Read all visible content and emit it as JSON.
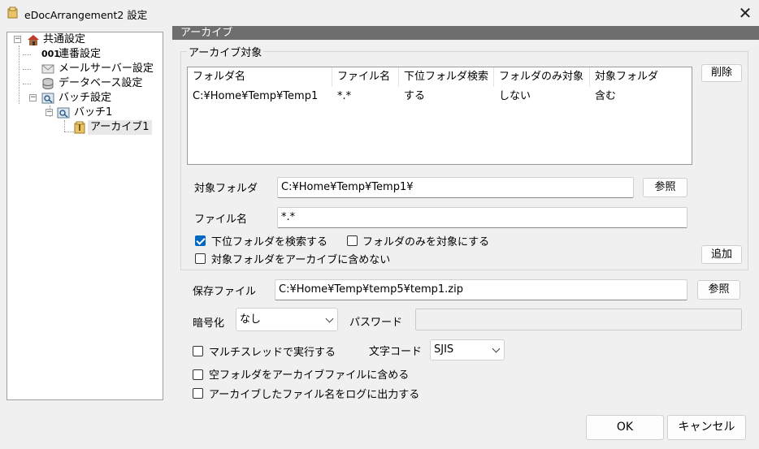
{
  "window": {
    "title": "eDocArrangement2 設定",
    "close_glyph": "✕"
  },
  "tree": {
    "items": [
      {
        "label": "共通設定",
        "icon": "house-icon"
      },
      {
        "label": "連番設定",
        "icon": "counter-001-icon",
        "icon_text": "001"
      },
      {
        "label": "メールサーバー設定",
        "icon": "mail-icon"
      },
      {
        "label": "データベース設定",
        "icon": "database-icon"
      },
      {
        "label": "バッチ設定",
        "icon": "batch-icon"
      },
      {
        "label": "バッチ1",
        "icon": "batch-icon"
      },
      {
        "label": "アーカイブ1",
        "icon": "zip-archive-icon"
      }
    ],
    "expander_minus": "−"
  },
  "section": {
    "title": "アーカイブ"
  },
  "archive_target": {
    "legend": "アーカイブ対象",
    "columns": [
      "フォルダ名",
      "ファイル名",
      "下位フォルダ検索",
      "フォルダのみ対象",
      "対象フォルダ"
    ],
    "rows": [
      [
        "C:¥Home¥Temp¥Temp1",
        "*.*",
        "する",
        "しない",
        "含む"
      ]
    ],
    "delete_label": "削除",
    "target_folder_label": "対象フォルダ",
    "target_folder_value": "C:¥Home¥Temp¥Temp1¥",
    "browse_label": "参照",
    "file_name_label": "ファイル名",
    "file_name_value": "*.*",
    "search_subfolders_label": "下位フォルダを検索する",
    "search_subfolders_checked": true,
    "folders_only_label": "フォルダのみを対象にする",
    "folders_only_checked": false,
    "exclude_target_label": "対象フォルダをアーカイブに含めない",
    "exclude_target_checked": false,
    "add_label": "追加"
  },
  "save": {
    "label": "保存ファイル",
    "value": "C:¥Home¥Temp¥temp5¥temp1.zip",
    "browse_label": "参照"
  },
  "encryption": {
    "label": "暗号化",
    "value": "なし",
    "password_label": "パスワード",
    "password_value": ""
  },
  "options": {
    "multithread_label": "マルチスレッドで実行する",
    "multithread_checked": false,
    "charcode_label": "文字コード",
    "charcode_value": "SJIS",
    "include_empty_label": "空フォルダをアーカイブファイルに含める",
    "include_empty_checked": false,
    "log_names_label": "アーカイブしたファイル名をログに出力する",
    "log_names_checked": false
  },
  "footer": {
    "ok_label": "OK",
    "cancel_label": "キャンセル"
  },
  "colors": {
    "accent": "#0067c0",
    "section_header_bg": "#6e6e6e"
  }
}
